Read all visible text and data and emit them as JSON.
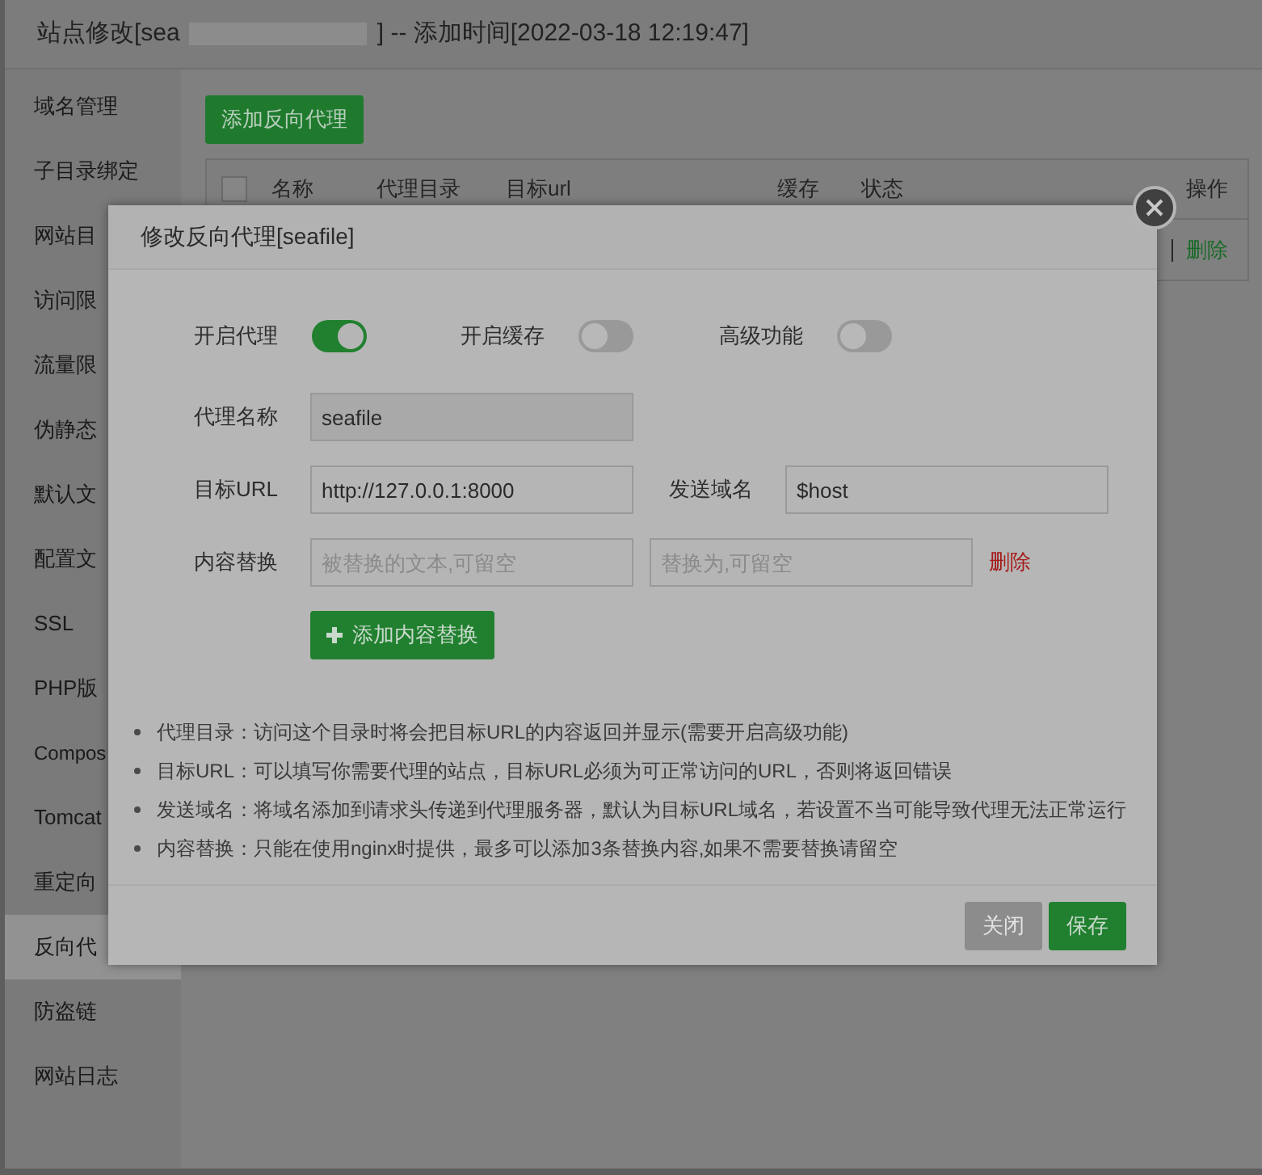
{
  "window": {
    "title_start": "站点修改[sea",
    "title_end": "] -- 添加时间[2022-03-18 12:19:47]"
  },
  "sidebar": {
    "items": [
      {
        "label": "域名管理",
        "selected": false
      },
      {
        "label": "子目录绑定",
        "selected": false
      },
      {
        "label": "网站目",
        "selected": false
      },
      {
        "label": "访问限",
        "selected": false
      },
      {
        "label": "流量限",
        "selected": false
      },
      {
        "label": "伪静态",
        "selected": false
      },
      {
        "label": "默认文",
        "selected": false
      },
      {
        "label": "配置文",
        "selected": false
      },
      {
        "label": "SSL",
        "selected": false
      },
      {
        "label": "PHP版",
        "selected": false
      },
      {
        "label": "Compos",
        "selected": false
      },
      {
        "label": "Tomcat",
        "selected": false
      },
      {
        "label": "重定向",
        "selected": false
      },
      {
        "label": "反向代",
        "selected": true
      },
      {
        "label": "防盗链",
        "selected": false
      },
      {
        "label": "网站日志",
        "selected": false
      }
    ]
  },
  "add_button": "添加反向代理",
  "table": {
    "select_all_checked": false,
    "columns": [
      "名称",
      "代理目录",
      "目标url",
      "缓存",
      "状态",
      "操作"
    ],
    "row_action": "删除"
  },
  "dialog": {
    "title": "修改反向代理[seafile]",
    "toggles": [
      {
        "label": "开启代理",
        "on": true
      },
      {
        "label": "开启缓存",
        "on": false
      },
      {
        "label": "高级功能",
        "on": false
      }
    ],
    "proxy_name": {
      "label": "代理名称",
      "value": "seafile",
      "disabled": true
    },
    "target_url": {
      "label": "目标URL",
      "value": "http://127.0.0.1:8000"
    },
    "send_domain": {
      "label": "发送域名",
      "value": "$host"
    },
    "content_replace": {
      "label": "内容替换",
      "from_placeholder": "被替换的文本,可留空",
      "to_placeholder": "替换为,可留空",
      "delete": "删除"
    },
    "add_replace_button": "添加内容替换",
    "notes": [
      "代理目录：访问这个目录时将会把目标URL的内容返回并显示(需要开启高级功能)",
      "目标URL：可以填写你需要代理的站点，目标URL必须为可正常访问的URL，否则将返回错误",
      "发送域名：将域名添加到请求头传递到代理服务器，默认为目标URL域名，若设置不当可能导致代理无法正常运行",
      "内容替换：只能在使用nginx时提供，最多可以添加3条替换内容,如果不需要替换请留空"
    ],
    "buttons": [
      {
        "label": "关闭",
        "kind": "secondary"
      },
      {
        "label": "保存",
        "kind": "primary"
      }
    ]
  }
}
